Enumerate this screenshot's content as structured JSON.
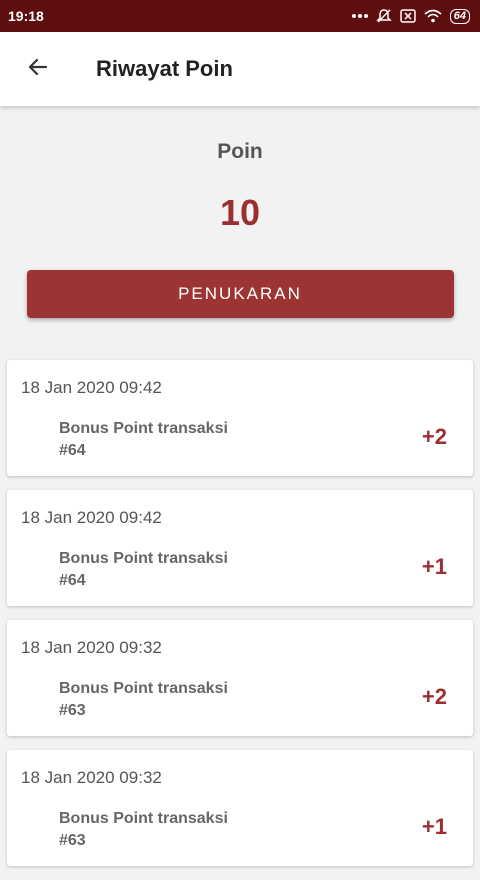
{
  "status_bar": {
    "time": "19:18",
    "battery": "64",
    "icons": [
      "more-dots-icon",
      "mute-icon",
      "sim-icon",
      "wifi-icon",
      "battery-icon"
    ]
  },
  "app_bar": {
    "title": "Riwayat Poin",
    "back_icon": "arrow-back-icon"
  },
  "summary": {
    "label": "Poin",
    "value": "10",
    "redeem_label": "PENUKARAN"
  },
  "colors": {
    "status_bar": "#5e0e0e",
    "accent": "#9c3434",
    "points_text": "#9b2f2f"
  },
  "history": [
    {
      "date": "18 Jan 2020 09:42",
      "description_line1": "Bonus Point transaksi",
      "description_line2": "#64",
      "points": "+2"
    },
    {
      "date": "18 Jan 2020 09:42",
      "description_line1": "Bonus Point transaksi",
      "description_line2": "#64",
      "points": "+1"
    },
    {
      "date": "18 Jan 2020 09:32",
      "description_line1": "Bonus Point transaksi",
      "description_line2": "#63",
      "points": "+2"
    },
    {
      "date": "18 Jan 2020 09:32",
      "description_line1": "Bonus Point transaksi",
      "description_line2": "#63",
      "points": "+1"
    }
  ]
}
